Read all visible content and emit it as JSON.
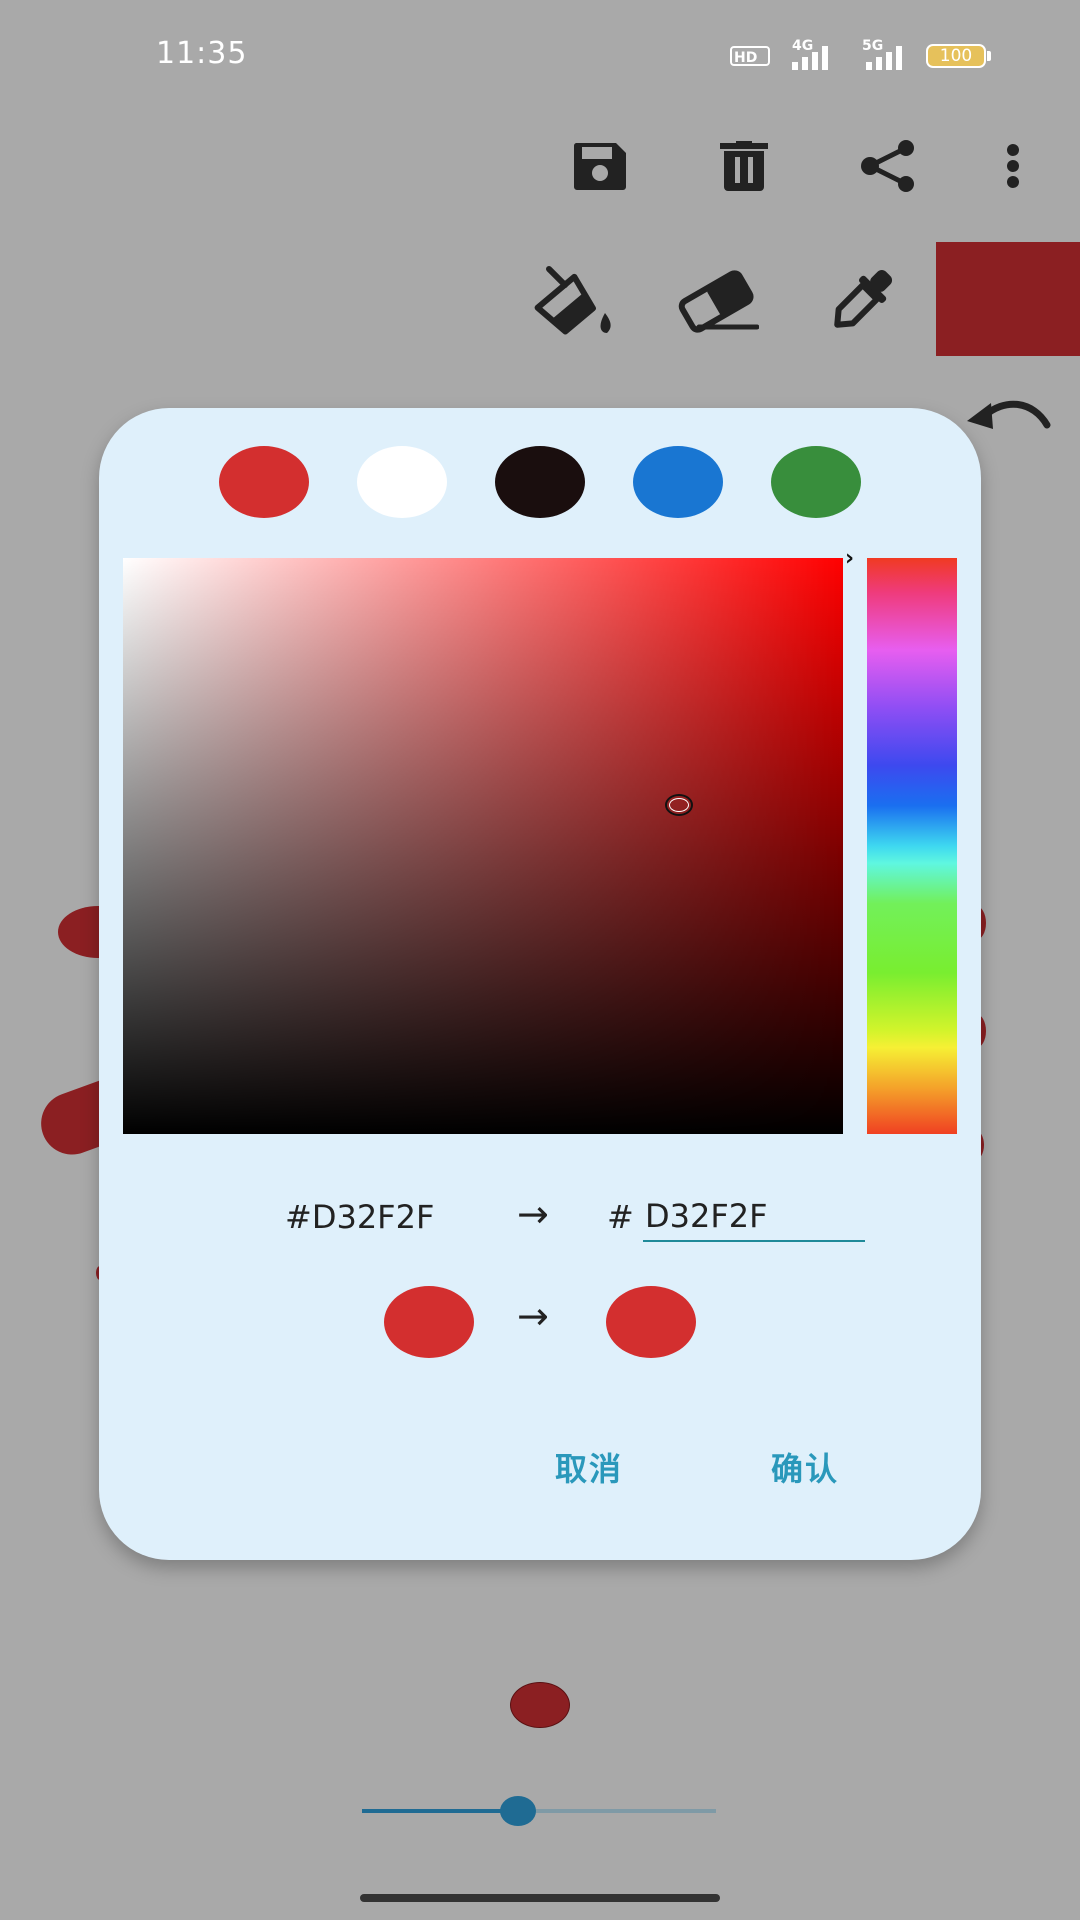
{
  "status_bar": {
    "time": "11:35",
    "hd_label": "HD",
    "net1": "4G",
    "net2": "5G",
    "battery": "100"
  },
  "toolbar": {
    "icons": [
      "save-icon",
      "delete-icon",
      "share-icon",
      "more-vert-icon"
    ]
  },
  "tools": {
    "icons": [
      "paint-bucket-icon",
      "eraser-icon",
      "eyedropper-icon"
    ],
    "current_color": "#8b1f22"
  },
  "dialog": {
    "presets": [
      "#d32f2f",
      "#ffffff",
      "#1a0e0e",
      "#1976d2",
      "#388e3c"
    ],
    "selected_hue": "#ff0000",
    "old_hex": "#D32F2F",
    "hash": "#",
    "new_hex": "D32F2F",
    "arrow": "→",
    "old_color": "#d32f2f",
    "new_color": "#d32f2f",
    "cancel_label": "取消",
    "confirm_label": "确认"
  },
  "bottom": {
    "brush_color": "#8b1f22",
    "brush_size_fraction": 0.44
  }
}
